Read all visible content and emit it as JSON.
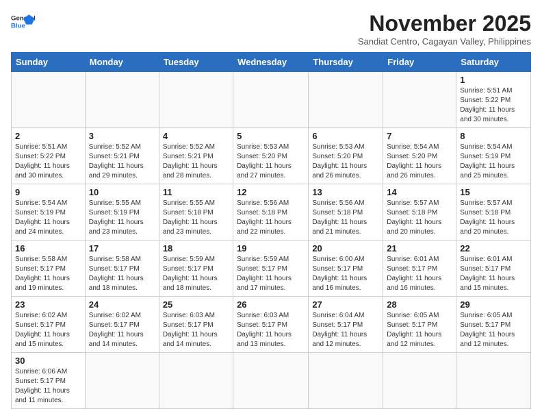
{
  "header": {
    "logo_general": "General",
    "logo_blue": "Blue",
    "month_title": "November 2025",
    "location": "Sandiat Centro, Cagayan Valley, Philippines"
  },
  "weekdays": [
    "Sunday",
    "Monday",
    "Tuesday",
    "Wednesday",
    "Thursday",
    "Friday",
    "Saturday"
  ],
  "days": [
    {
      "num": "",
      "info": ""
    },
    {
      "num": "",
      "info": ""
    },
    {
      "num": "",
      "info": ""
    },
    {
      "num": "",
      "info": ""
    },
    {
      "num": "",
      "info": ""
    },
    {
      "num": "",
      "info": ""
    },
    {
      "num": "1",
      "info": "Sunrise: 5:51 AM\nSunset: 5:22 PM\nDaylight: 11 hours\nand 30 minutes."
    },
    {
      "num": "2",
      "info": "Sunrise: 5:51 AM\nSunset: 5:22 PM\nDaylight: 11 hours\nand 30 minutes."
    },
    {
      "num": "3",
      "info": "Sunrise: 5:52 AM\nSunset: 5:21 PM\nDaylight: 11 hours\nand 29 minutes."
    },
    {
      "num": "4",
      "info": "Sunrise: 5:52 AM\nSunset: 5:21 PM\nDaylight: 11 hours\nand 28 minutes."
    },
    {
      "num": "5",
      "info": "Sunrise: 5:53 AM\nSunset: 5:20 PM\nDaylight: 11 hours\nand 27 minutes."
    },
    {
      "num": "6",
      "info": "Sunrise: 5:53 AM\nSunset: 5:20 PM\nDaylight: 11 hours\nand 26 minutes."
    },
    {
      "num": "7",
      "info": "Sunrise: 5:54 AM\nSunset: 5:20 PM\nDaylight: 11 hours\nand 26 minutes."
    },
    {
      "num": "8",
      "info": "Sunrise: 5:54 AM\nSunset: 5:19 PM\nDaylight: 11 hours\nand 25 minutes."
    },
    {
      "num": "9",
      "info": "Sunrise: 5:54 AM\nSunset: 5:19 PM\nDaylight: 11 hours\nand 24 minutes."
    },
    {
      "num": "10",
      "info": "Sunrise: 5:55 AM\nSunset: 5:19 PM\nDaylight: 11 hours\nand 23 minutes."
    },
    {
      "num": "11",
      "info": "Sunrise: 5:55 AM\nSunset: 5:18 PM\nDaylight: 11 hours\nand 23 minutes."
    },
    {
      "num": "12",
      "info": "Sunrise: 5:56 AM\nSunset: 5:18 PM\nDaylight: 11 hours\nand 22 minutes."
    },
    {
      "num": "13",
      "info": "Sunrise: 5:56 AM\nSunset: 5:18 PM\nDaylight: 11 hours\nand 21 minutes."
    },
    {
      "num": "14",
      "info": "Sunrise: 5:57 AM\nSunset: 5:18 PM\nDaylight: 11 hours\nand 20 minutes."
    },
    {
      "num": "15",
      "info": "Sunrise: 5:57 AM\nSunset: 5:18 PM\nDaylight: 11 hours\nand 20 minutes."
    },
    {
      "num": "16",
      "info": "Sunrise: 5:58 AM\nSunset: 5:17 PM\nDaylight: 11 hours\nand 19 minutes."
    },
    {
      "num": "17",
      "info": "Sunrise: 5:58 AM\nSunset: 5:17 PM\nDaylight: 11 hours\nand 18 minutes."
    },
    {
      "num": "18",
      "info": "Sunrise: 5:59 AM\nSunset: 5:17 PM\nDaylight: 11 hours\nand 18 minutes."
    },
    {
      "num": "19",
      "info": "Sunrise: 5:59 AM\nSunset: 5:17 PM\nDaylight: 11 hours\nand 17 minutes."
    },
    {
      "num": "20",
      "info": "Sunrise: 6:00 AM\nSunset: 5:17 PM\nDaylight: 11 hours\nand 16 minutes."
    },
    {
      "num": "21",
      "info": "Sunrise: 6:01 AM\nSunset: 5:17 PM\nDaylight: 11 hours\nand 16 minutes."
    },
    {
      "num": "22",
      "info": "Sunrise: 6:01 AM\nSunset: 5:17 PM\nDaylight: 11 hours\nand 15 minutes."
    },
    {
      "num": "23",
      "info": "Sunrise: 6:02 AM\nSunset: 5:17 PM\nDaylight: 11 hours\nand 15 minutes."
    },
    {
      "num": "24",
      "info": "Sunrise: 6:02 AM\nSunset: 5:17 PM\nDaylight: 11 hours\nand 14 minutes."
    },
    {
      "num": "25",
      "info": "Sunrise: 6:03 AM\nSunset: 5:17 PM\nDaylight: 11 hours\nand 14 minutes."
    },
    {
      "num": "26",
      "info": "Sunrise: 6:03 AM\nSunset: 5:17 PM\nDaylight: 11 hours\nand 13 minutes."
    },
    {
      "num": "27",
      "info": "Sunrise: 6:04 AM\nSunset: 5:17 PM\nDaylight: 11 hours\nand 12 minutes."
    },
    {
      "num": "28",
      "info": "Sunrise: 6:05 AM\nSunset: 5:17 PM\nDaylight: 11 hours\nand 12 minutes."
    },
    {
      "num": "29",
      "info": "Sunrise: 6:05 AM\nSunset: 5:17 PM\nDaylight: 11 hours\nand 12 minutes."
    },
    {
      "num": "30",
      "info": "Sunrise: 6:06 AM\nSunset: 5:17 PM\nDaylight: 11 hours\nand 11 minutes."
    },
    {
      "num": "",
      "info": ""
    },
    {
      "num": "",
      "info": ""
    },
    {
      "num": "",
      "info": ""
    },
    {
      "num": "",
      "info": ""
    },
    {
      "num": "",
      "info": ""
    },
    {
      "num": "",
      "info": ""
    }
  ]
}
